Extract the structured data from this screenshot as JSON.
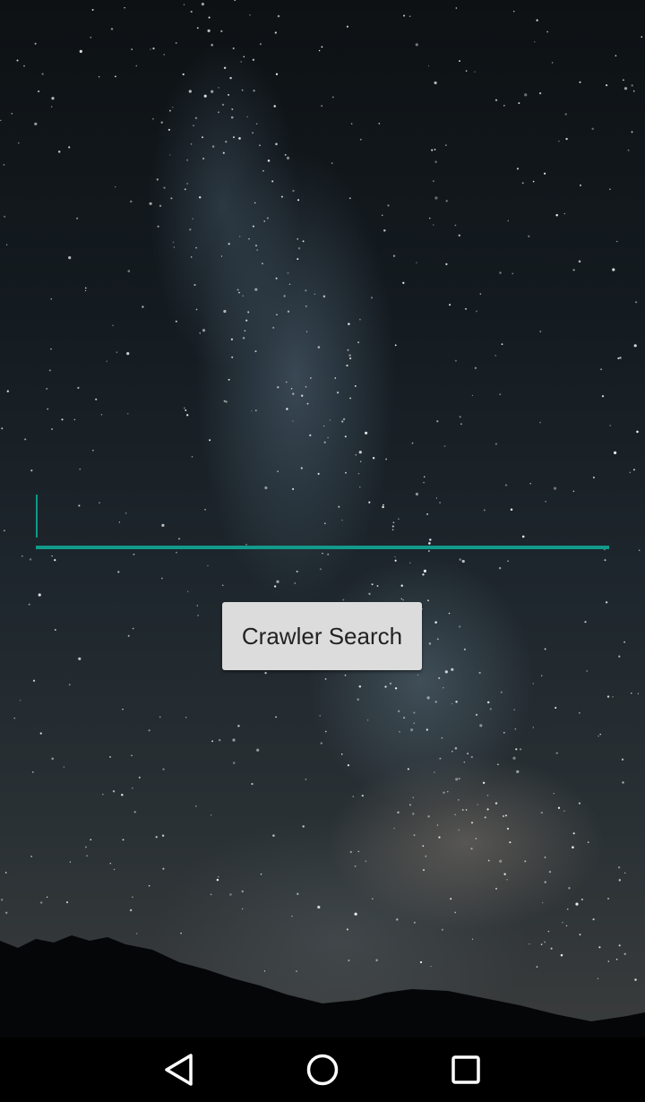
{
  "search": {
    "value": "",
    "placeholder": "",
    "button_label": "Crawler Search"
  },
  "colors": {
    "accent": "#129a8c",
    "button_bg": "#dcdcdc",
    "nav_bar_bg": "#000000"
  },
  "nav_bar": {
    "buttons": [
      "back-icon",
      "home-icon",
      "recents-icon"
    ]
  }
}
